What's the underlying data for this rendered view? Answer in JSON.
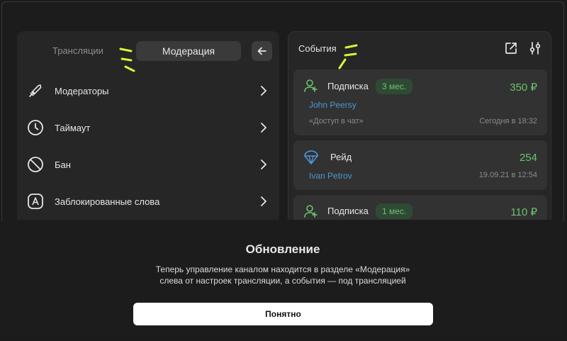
{
  "moderation_panel": {
    "tabs": {
      "streams": "Трансляции",
      "moderation": "Модерация"
    },
    "back_icon": "arrow-left-icon",
    "items": [
      {
        "label": "Модераторы",
        "icon": "sword-icon"
      },
      {
        "label": "Таймаут",
        "icon": "clock-icon"
      },
      {
        "label": "Бан",
        "icon": "ban-icon"
      },
      {
        "label": "Заблокированные слова",
        "icon": "letter-a-box-icon"
      }
    ]
  },
  "events_panel": {
    "title": "События",
    "header_icons": [
      "external-link-icon",
      "sliders-icon"
    ],
    "events": [
      {
        "type": "Подписка",
        "badge": "3 мес.",
        "amount": "350 ₽",
        "user": "John Peersy",
        "note": "«Доступ в чат»",
        "time": "Сегодня в 18:32",
        "icon": "user-plus-icon"
      },
      {
        "type": "Рейд",
        "amount": "254",
        "user": "Ivan Petrov",
        "time": "19.09.21 в 12:54",
        "icon": "parachute-icon"
      },
      {
        "type": "Подписка",
        "badge": "1 мес.",
        "amount": "110 ₽",
        "icon": "user-plus-icon"
      }
    ]
  },
  "dialog": {
    "title": "Обновление",
    "line1": "Теперь управление каналом находится в разделе «Модерация»",
    "line2": "слева от настроек трансляции, а события — под трансляцией",
    "button": "Понятно"
  },
  "colors": {
    "accent_green": "#6cc36c",
    "highlight": "#d7f53a",
    "link_blue": "#4f97d8"
  }
}
